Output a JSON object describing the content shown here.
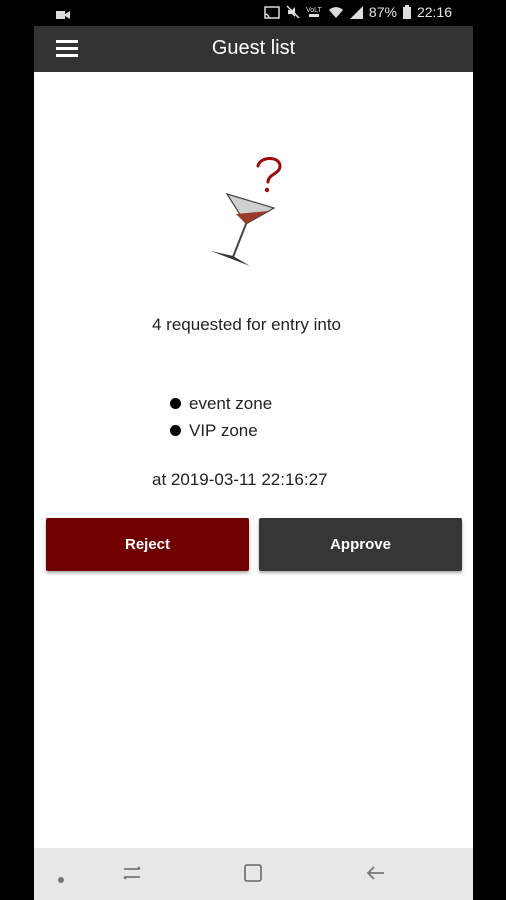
{
  "status_bar": {
    "battery": "87%",
    "time": "22:16"
  },
  "app_bar": {
    "title": "Guest list"
  },
  "request": {
    "message": "4 requested for entry into",
    "zones": [
      "event zone",
      "VIP zone"
    ],
    "timestamp_line": "at 2019-03-11 22:16:27"
  },
  "actions": {
    "reject_label": "Reject",
    "approve_label": "Approve"
  },
  "colors": {
    "app_bar": "#333333",
    "reject": "#700000",
    "approve": "#363636",
    "accent_red": "#9b0a0a"
  }
}
